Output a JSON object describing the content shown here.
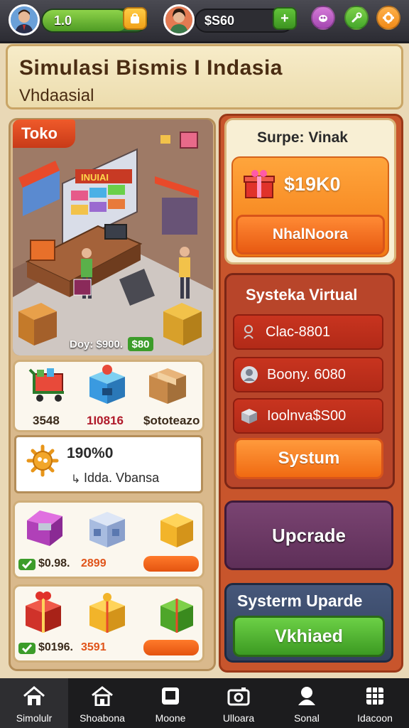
{
  "top_bar": {
    "level_value": "1.0",
    "money_value": "$S60",
    "plus_icon": "plus-icon",
    "icons": [
      "bag-icon",
      "bug-icon",
      "wrench-icon",
      "gear-icon"
    ]
  },
  "header": {
    "title": "Simulasi Bismis I Indasia",
    "subtitle": "Vhdaasial"
  },
  "store": {
    "tag": "Toko",
    "sign": "INUIAI",
    "day_label": "Doy: $900.",
    "day_badge": "$80"
  },
  "inventory_row1": [
    {
      "icon": "cart-icon",
      "value": "3548",
      "color": "#3a2a1a"
    },
    {
      "icon": "blue-box-icon",
      "value": "1I0816",
      "color": "#b01a2a"
    },
    {
      "icon": "cardboard-box-icon",
      "value": "$ototeazo",
      "color": "#3a2a1a"
    }
  ],
  "info_card": {
    "value": "190%0",
    "subtitle": "Idda. Vbansa"
  },
  "inventory_row2": {
    "icons": [
      "purple-chest-icon",
      "blue-crate-icon",
      "gold-box-icon"
    ],
    "price": "$0.98.",
    "price_red": "2899"
  },
  "inventory_row3": {
    "icons": [
      "red-gift-icon",
      "gold-gift-icon",
      "green-gift-icon"
    ],
    "price": "$0196.",
    "price_red": "3591"
  },
  "right_top": {
    "title": "Surpe: Vinak",
    "price": "$19K0",
    "button": "NhalNoora"
  },
  "systeka": {
    "title": "Systeka Virtual",
    "rows": [
      {
        "icon": "user-icon",
        "text": "Clac-8801"
      },
      {
        "icon": "person-icon",
        "text": "Boony. 6080"
      },
      {
        "icon": "box-icon",
        "text": "Ioolnva$S00"
      }
    ],
    "button": "Systum"
  },
  "upgrade": {
    "label": "Upcrade"
  },
  "system_upgrade": {
    "title": "Systerm Uparde",
    "button": "Vkhiaed"
  },
  "bottom_nav": [
    {
      "icon": "home-icon",
      "label": "Simolulr"
    },
    {
      "icon": "house-icon",
      "label": "Shoabona"
    },
    {
      "icon": "phone-icon",
      "label": "Moone"
    },
    {
      "icon": "camera-icon",
      "label": "Ulloara"
    },
    {
      "icon": "social-icon",
      "label": "Sonal"
    },
    {
      "icon": "grid-icon",
      "label": "Idacoon"
    }
  ],
  "colors": {
    "accent_orange": "#f06a12",
    "panel_red": "#c8432a",
    "upgrade_purple": "#6b3a66",
    "upgrade_navy": "#3a4a6a",
    "button_green": "#44a62a"
  }
}
